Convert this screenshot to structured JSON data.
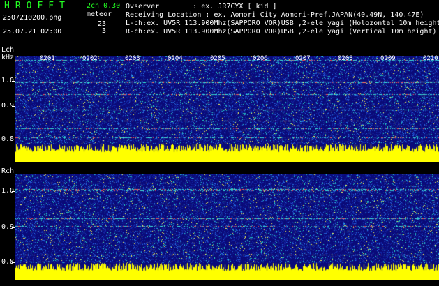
{
  "header": {
    "logo": "HROFFT",
    "version": "2ch 0.30",
    "meteor_label": "meteor",
    "filename": "2507210200.png",
    "datetime": "25.07.21 02:00",
    "count_l": "23",
    "count_r": "3"
  },
  "info": {
    "observer_label": "Ovserver",
    "observer_value": ": ex. JR7CYX [ kid ]",
    "location_label": "Receiving Location",
    "location_value": ": ex. Aomori City Aomori-Pref.JAPAN(40.49N, 140.47E)",
    "lch": "L-ch:ex. UV5R 113.900Mhz(SAPPORO VOR)USB ,2-ele yagi (Holozontal 10m height)",
    "rch": "R-ch:ex. UV5R 113.900Mhz(SAPPORO VOR)USB ,2-ele yagi (Vertical 10m height)"
  },
  "panels": {
    "lch_label": "Lch",
    "khz_label": "kHz",
    "rch_label": "Rch",
    "y_ticks_l": [
      "1.0",
      "0.9",
      "0.8"
    ],
    "y_ticks_r": [
      "1.0",
      "0.9",
      "0.8"
    ],
    "time_ticks": [
      "0201",
      "0202",
      "0203",
      "0204",
      "0205",
      "0206",
      "0207",
      "0208",
      "0209",
      "0210"
    ]
  },
  "colors": {
    "waterfall_bg": "#0a0a7a",
    "signal_bar": "#ffff00",
    "header_green": "#22ff22"
  }
}
